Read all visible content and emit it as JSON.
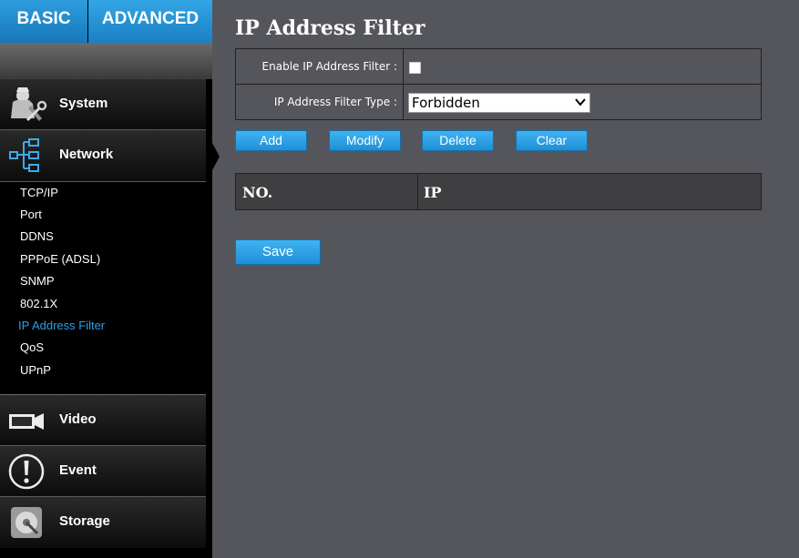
{
  "top_tabs": {
    "basic": "BASIC",
    "advanced": "ADVANCED"
  },
  "sidebar": {
    "sections": {
      "system": "System",
      "network": "Network",
      "video": "Video",
      "event": "Event",
      "storage": "Storage"
    },
    "network_items": [
      {
        "label": "TCP/IP"
      },
      {
        "label": "Port"
      },
      {
        "label": "DDNS"
      },
      {
        "label": "PPPoE (ADSL)"
      },
      {
        "label": "SNMP"
      },
      {
        "label": "802.1X"
      },
      {
        "label": "IP Address Filter",
        "active": true
      },
      {
        "label": "QoS"
      },
      {
        "label": "UPnP"
      }
    ],
    "icons": {
      "system": "settings-person-icon",
      "network": "network-tree-icon",
      "video": "video-camera-icon",
      "event": "exclamation-icon",
      "storage": "hard-disk-icon"
    },
    "active_color": "#2f9fe6"
  },
  "main": {
    "title": "IP Address Filter",
    "enable_label": "Enable IP Address Filter :",
    "enable_checked": false,
    "type_label": "IP Address Filter Type :",
    "type_value": "Forbidden",
    "buttons": {
      "add": "Add",
      "modify": "Modify",
      "delete": "Delete",
      "clear": "Clear"
    },
    "list_columns": {
      "no": "NO.",
      "ip": "IP"
    },
    "save": "Save"
  },
  "colors": {
    "accent": "#2596dc",
    "background": "#55565b",
    "sidebar": "#000000"
  }
}
